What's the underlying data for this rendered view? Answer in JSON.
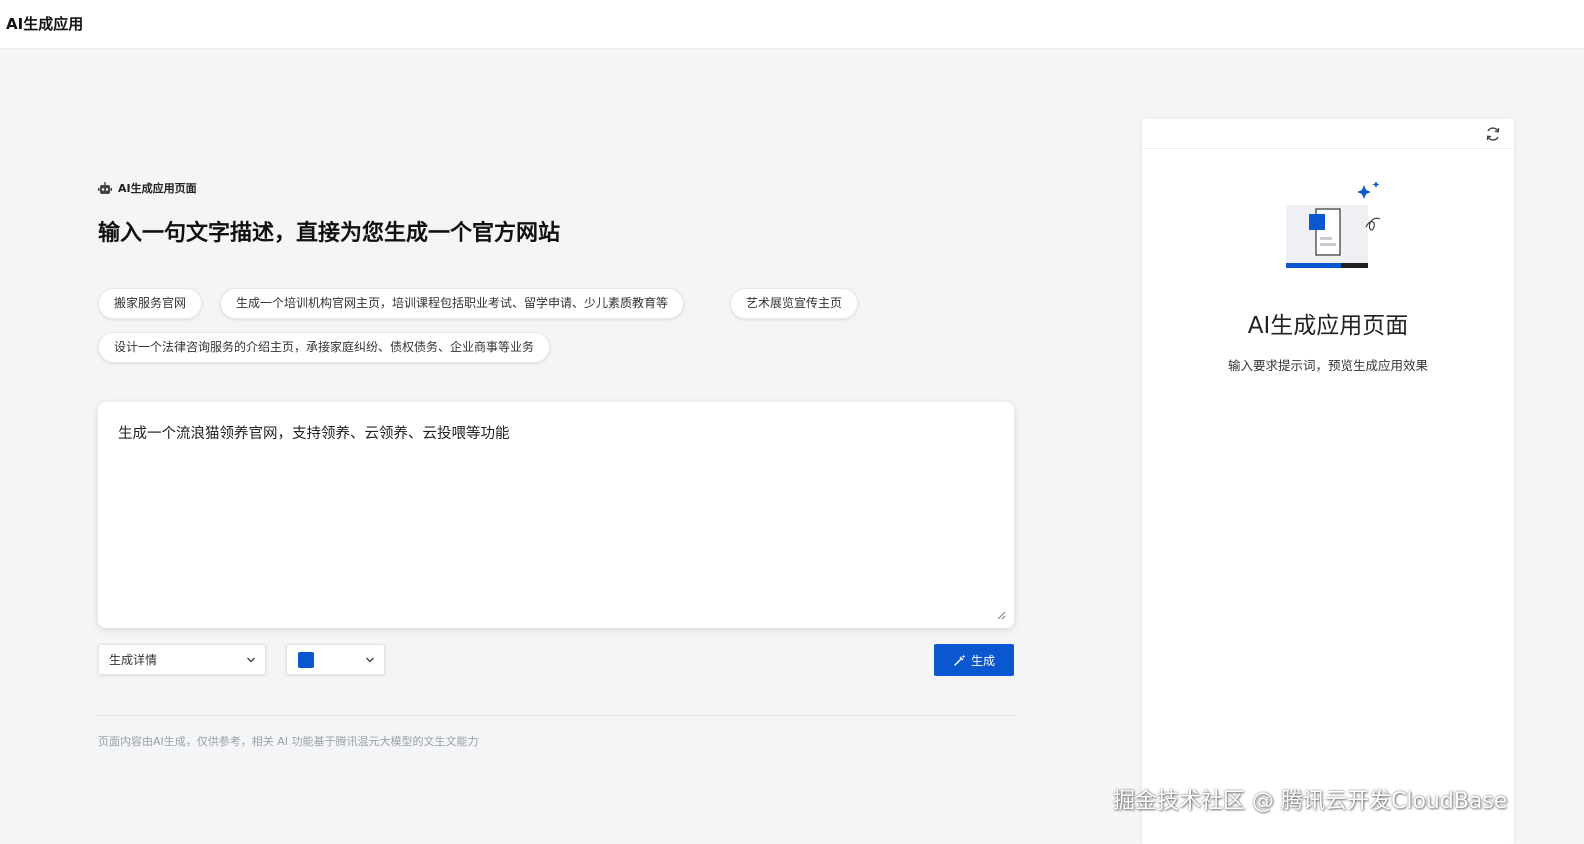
{
  "app": {
    "title": "AI生成应用"
  },
  "main": {
    "crumb_label": "AI生成应用页面",
    "headline": "输入一句文字描述，直接为您生成一个官方网站",
    "suggestions": [
      "搬家服务官网",
      "生成一个培训机构官网主页，培训课程包括职业考试、留学申请、少儿素质教育等",
      "艺术展览宣传主页",
      "设计一个法律咨询服务的介绍主页，承接家庭纠纷、债权债务、企业商事等业务"
    ],
    "prompt_value": "生成一个流浪猫领养官网，支持领养、云领养、云投喂等功能",
    "detail_select": {
      "value": "生成详情"
    },
    "color_select": {
      "value": "#0b57d0"
    },
    "generate_label": "生成",
    "disclaimer": "页面内容由AI生成，仅供参考，相关 AI 功能基于腾讯混元大模型的文生文能力"
  },
  "preview": {
    "title": "AI生成应用页面",
    "subtitle": "输入要求提示词，预览生成应用效果"
  },
  "watermark": "掘金技术社区 @ 腾讯云开发CloudBase",
  "colors": {
    "accent": "#0b57d0",
    "background": "#f4f5f7",
    "panel": "#ffffff"
  },
  "icons": {
    "crumb": "robot-icon",
    "generate": "magic-wand-icon",
    "refresh": "refresh-icon",
    "select": "chevron-down-icon"
  }
}
